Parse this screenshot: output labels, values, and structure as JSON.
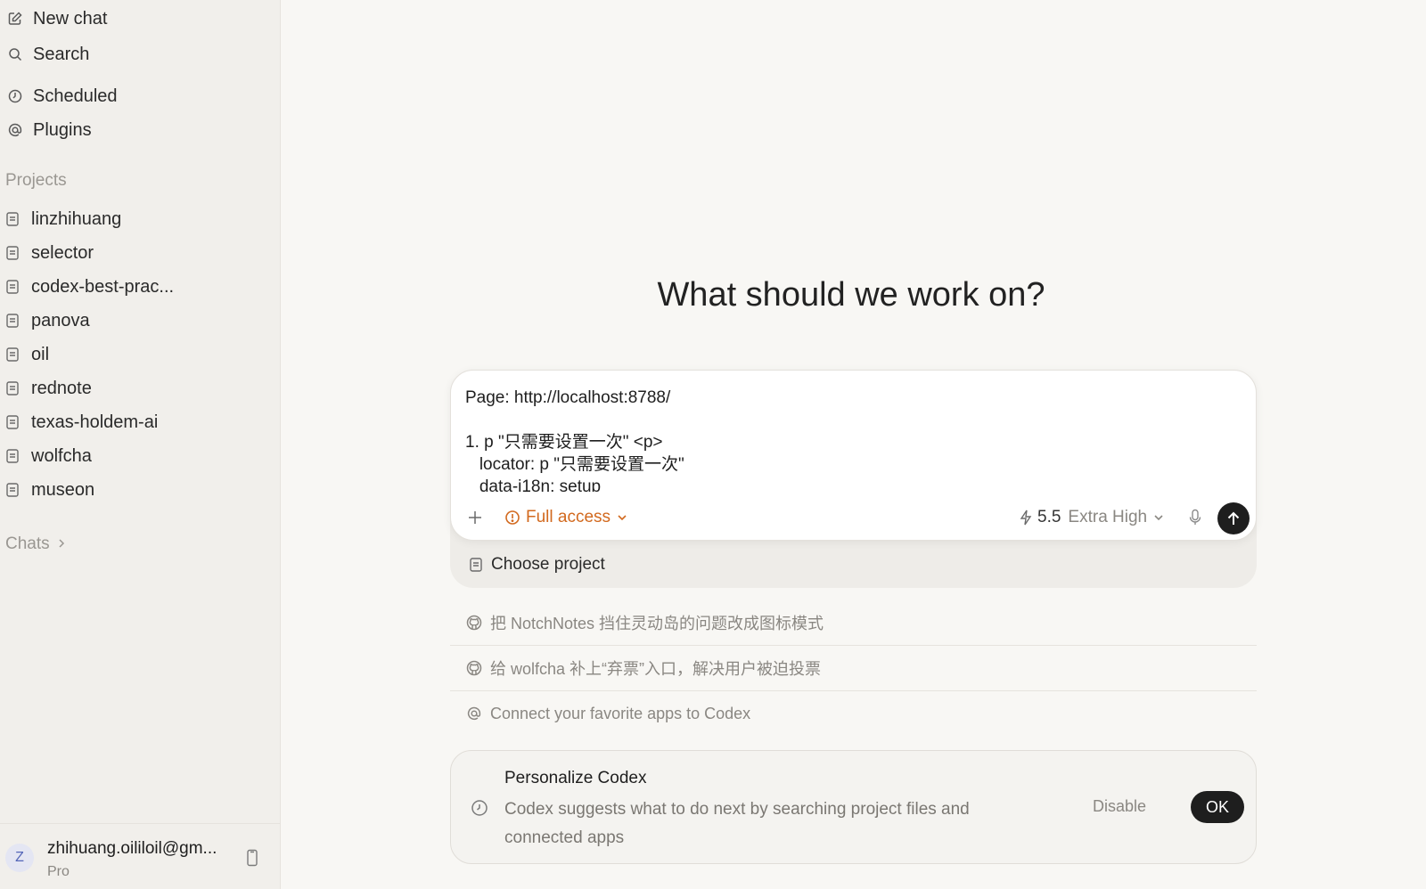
{
  "sidebar": {
    "nav": [
      {
        "label": "New chat",
        "icon": "compose-icon"
      },
      {
        "label": "Search",
        "icon": "search-icon"
      },
      {
        "label": "Scheduled",
        "icon": "clock-icon"
      },
      {
        "label": "Plugins",
        "icon": "at-sign-icon"
      }
    ],
    "projects_label": "Projects",
    "projects": [
      {
        "label": "linzhihuang"
      },
      {
        "label": "selector"
      },
      {
        "label": "codex-best-prac..."
      },
      {
        "label": "panova"
      },
      {
        "label": "oil"
      },
      {
        "label": "rednote"
      },
      {
        "label": "texas-holdem-ai"
      },
      {
        "label": "wolfcha"
      },
      {
        "label": "museon"
      }
    ],
    "chats_label": "Chats",
    "account": {
      "avatar_letter": "Z",
      "email": "zhihuang.oililoil@gm...",
      "plan": "Pro"
    }
  },
  "main": {
    "headline": "What should we work on?",
    "composer": {
      "text": "Page: http://localhost:8788/\n\n1. p \"只需要设置一次\" <p>\n   locator: p \"只需要设置一次\"\n   data-i18n: setup",
      "access_label": "Full access",
      "model_version": "5.5",
      "effort_label": "Extra High",
      "access_color": "#d2691e"
    },
    "choose_project_label": "Choose project",
    "suggestions": [
      {
        "label": "把 NotchNotes 挡住灵动岛的问题改成图标模式",
        "icon": "github-icon"
      },
      {
        "label": "给 wolfcha 补上“弃票”入口，解决用户被迫投票",
        "icon": "github-icon"
      },
      {
        "label": "Connect your favorite apps to Codex",
        "icon": "at-sign-icon"
      }
    ],
    "personalize_card": {
      "title": "Personalize Codex",
      "description": "Codex suggests what to do next by searching project files and connected apps",
      "disable_label": "Disable",
      "ok_label": "OK"
    }
  }
}
